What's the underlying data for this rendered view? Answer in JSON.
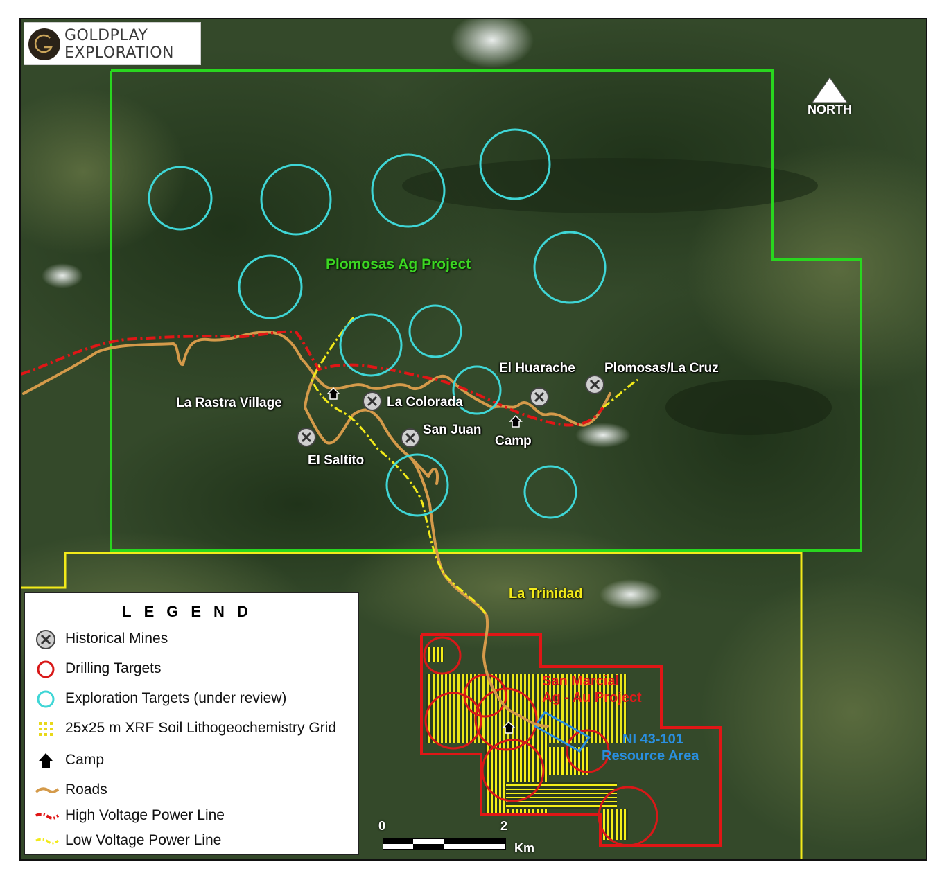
{
  "logo": {
    "line1": "GOLDPLAY",
    "line2": "EXPLORATION"
  },
  "north_label": "NORTH",
  "projects": {
    "plomosas": "Plomosas Ag Project",
    "trinidad": "La Trinidad",
    "san_marcial_line1": "San Marcial",
    "san_marcial_line2": "Ag - Au Project",
    "ni_line1": "NI 43-101",
    "ni_line2": "Resource Area"
  },
  "places": {
    "la_rastra": "La Rastra Village",
    "la_colorada": "La Colorada",
    "el_saltito": "El Saltito",
    "san_juan": "San Juan",
    "el_huarache": "El Huarache",
    "camp": "Camp",
    "plomosas_la_cruz": "Plomosas/La Cruz"
  },
  "legend": {
    "title": "LEGEND",
    "items": [
      {
        "label": "Historical Mines",
        "icon": "mine-icon"
      },
      {
        "label": "Drilling Targets",
        "icon": "red-circle-icon"
      },
      {
        "label": "Exploration Targets (under review)",
        "icon": "cyan-circle-icon"
      },
      {
        "label": "25x25 m XRF Soil Lithogeochemistry Grid",
        "icon": "yellow-grid-icon"
      },
      {
        "label": "Camp",
        "icon": "camp-icon"
      },
      {
        "label": "Roads",
        "icon": "road-icon"
      },
      {
        "label": "High Voltage Power Line",
        "icon": "high-voltage-line-icon"
      },
      {
        "label": "Low Voltage Power Line",
        "icon": "low-voltage-line-icon"
      }
    ]
  },
  "scale": {
    "start": "0",
    "mid": "2",
    "unit": "Km"
  },
  "colors": {
    "plomosas_boundary": "#29d61f",
    "trinidad_boundary": "#f2ea1a",
    "san_marcial_boundary": "#e01616",
    "exploration_targets": "#3fd6d6",
    "drilling_targets": "#d81818",
    "roads": "#d49a4a",
    "ni_area": "#2a8fe0"
  }
}
